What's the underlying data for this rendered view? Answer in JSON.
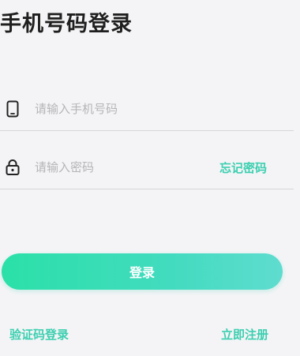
{
  "header": {
    "title": "手机号码登录"
  },
  "form": {
    "phone": {
      "placeholder": "请输入手机号码",
      "value": "",
      "icon": "phone-icon"
    },
    "password": {
      "placeholder": "请输入密码",
      "value": "",
      "icon": "lock-icon",
      "forgot_label": "忘记密码"
    },
    "login_label": "登录"
  },
  "footer": {
    "sms_login_label": "验证码登录",
    "register_label": "立即注册"
  },
  "colors": {
    "accent": "#3ccfb0",
    "button_gradient_start": "#2be0a8",
    "button_gradient_end": "#5fdccf",
    "background": "#f4f4f6"
  }
}
